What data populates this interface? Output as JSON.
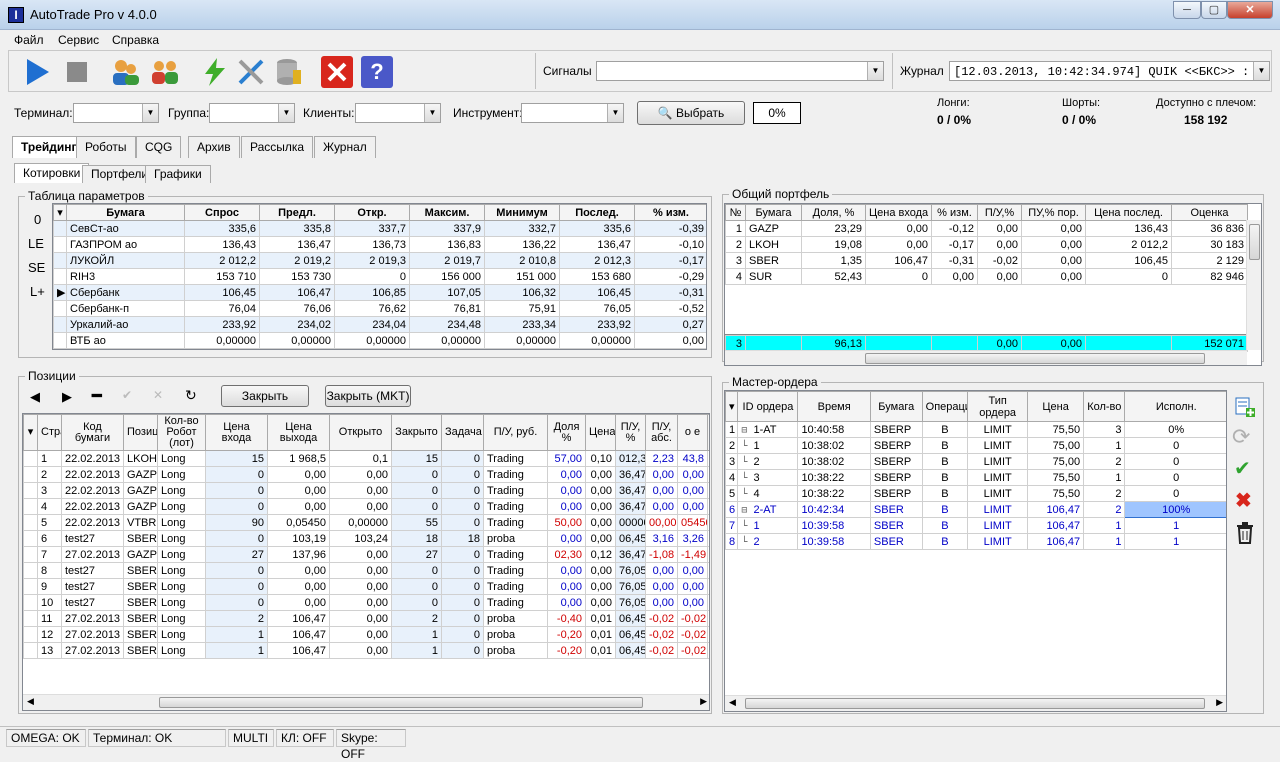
{
  "window": {
    "title": "AutoTrade Pro v 4.0.0",
    "minimize": "─",
    "maximize": "▢",
    "close": "✕"
  },
  "menu": [
    "Файл",
    "Сервис",
    "Справка"
  ],
  "toolbar": {
    "signals_label": "Сигналы",
    "signals_value": "",
    "journal_label": "Журнал",
    "journal_value": "[12.03.2013, 10:42:34.974] QUIK <<БКС>> : Т"
  },
  "filters": {
    "terminal_label": "Терминал:",
    "group_label": "Группа:",
    "clients_label": "Клиенты:",
    "instrument_label": "Инструмент:",
    "select_button": "Выбрать",
    "percent": "0%"
  },
  "summary": {
    "longs_label": "Лонги:",
    "longs_value": "0 / 0%",
    "shorts_label": "Шорты:",
    "shorts_value": "0 / 0%",
    "available_label": "Доступно с плечом:",
    "available_value": "158 192"
  },
  "tabs": [
    "Трейдинг",
    "Роботы",
    "CQG",
    "Архив",
    "Рассылка",
    "Журнал"
  ],
  "subtabs": [
    "Котировки",
    "Портфели",
    "Графики"
  ],
  "params": {
    "title": "Таблица параметров",
    "side_labels": [
      "0",
      "LE",
      "SE",
      "L+"
    ],
    "columns": [
      "Бумага",
      "Спрос",
      "Предл.",
      "Откр.",
      "Максим.",
      "Минимум",
      "Послед.",
      "% изм."
    ],
    "rows": [
      [
        "СевСт-ао",
        "335,6",
        "335,8",
        "337,7",
        "337,9",
        "332,7",
        "335,6",
        "-0,39"
      ],
      [
        "ГАЗПРОМ ао",
        "136,43",
        "136,47",
        "136,73",
        "136,83",
        "136,22",
        "136,47",
        "-0,10"
      ],
      [
        "ЛУКОЙЛ",
        "2 012,2",
        "2 019,2",
        "2 019,3",
        "2 019,7",
        "2 010,8",
        "2 012,3",
        "-0,17"
      ],
      [
        "RIH3",
        "153 710",
        "153 730",
        "0",
        "156 000",
        "151 000",
        "153 680",
        "-0,29"
      ],
      [
        "Сбербанк",
        "106,45",
        "106,47",
        "106,85",
        "107,05",
        "106,32",
        "106,45",
        "-0,31"
      ],
      [
        "Сбербанк-п",
        "76,04",
        "76,06",
        "76,62",
        "76,81",
        "75,91",
        "76,05",
        "-0,52"
      ],
      [
        "Уркалий-ао",
        "233,92",
        "234,02",
        "234,04",
        "234,48",
        "233,34",
        "233,92",
        "0,27"
      ],
      [
        "ВТБ ао",
        "0,00000",
        "0,00000",
        "0,00000",
        "0,00000",
        "0,00000",
        "0,00000",
        "0,00"
      ]
    ]
  },
  "portfolio": {
    "title": "Общий портфель",
    "columns": [
      "№",
      "Бумага",
      "Доля, %",
      "Цена входа",
      "% изм.",
      "П/У,%",
      "ПУ,% пор.",
      "Цена послед.",
      "Оценка"
    ],
    "rows": [
      [
        "1",
        "GAZP",
        "23,29",
        "0,00",
        "-0,12",
        "0,00",
        "0,00",
        "136,43",
        "36 836"
      ],
      [
        "2",
        "LKOH",
        "19,08",
        "0,00",
        "-0,17",
        "0,00",
        "0,00",
        "2 012,2",
        "30 183"
      ],
      [
        "3",
        "SBER",
        "1,35",
        "106,47",
        "-0,31",
        "-0,02",
        "0,00",
        "106,45",
        "2 129"
      ],
      [
        "4",
        "SUR",
        "52,43",
        "0",
        "0,00",
        "0,00",
        "0,00",
        "0",
        "82 946"
      ]
    ],
    "total": [
      "3",
      "",
      "96,13",
      "",
      "",
      "0,00",
      "0,00",
      "",
      "152 071"
    ]
  },
  "positions": {
    "title": "Позиции",
    "close_button": "Закрыть",
    "close_mkt_button": "Закрыть (MKT)",
    "columns": [
      "",
      "Стратегия",
      "Код бумаги",
      "Позиция",
      "Кол-во Робот (лот)",
      "Цена входа",
      "Цена выхода",
      "Открыто",
      "Закрыто",
      "Задача",
      "П/У, руб.",
      "Доля %",
      "Цена",
      "П/У, %",
      "П/У, абс.",
      "о е",
      "%"
    ],
    "rows": [
      [
        "1",
        "22.02.2013 1",
        "LKOH",
        "Long",
        "15",
        "1 968,5",
        "0,1",
        "15",
        "0",
        "Trading",
        "57,00",
        "0,10",
        "012,3",
        "2,23",
        "43,8",
        "1"
      ],
      [
        "2",
        "22.02.2013 1",
        "GAZP",
        "Long",
        "0",
        "0,00",
        "0,00",
        "0",
        "0",
        "Trading",
        "0,00",
        "0,00",
        "36,47",
        "0,00",
        "0,00",
        "1"
      ],
      [
        "3",
        "22.02.2013 1",
        "GAZP",
        "Long",
        "0",
        "0,00",
        "0,00",
        "0",
        "0",
        "Trading",
        "0,00",
        "0,00",
        "36,47",
        "0,00",
        "0,00",
        "1"
      ],
      [
        "4",
        "22.02.2013 1",
        "GAZP",
        "Long",
        "0",
        "0,00",
        "0,00",
        "0",
        "0",
        "Trading",
        "0,00",
        "0,00",
        "36,47",
        "0,00",
        "0,00",
        "1"
      ],
      [
        "5",
        "22.02.2013 1",
        "VTBR",
        "Long",
        "90",
        "0,05450",
        "0,00000",
        "55",
        "0",
        "Trading",
        "50,00",
        "0,00",
        "00000",
        "00,00",
        "05450",
        "1"
      ],
      [
        "6",
        "test27",
        "SBER",
        "Long",
        "0",
        "103,19",
        "103,24",
        "18",
        "18",
        "proba",
        "0,00",
        "0,00",
        "06,45",
        "3,16",
        "3,26",
        "1"
      ],
      [
        "7",
        "27.02.2013 1",
        "GAZP",
        "Long",
        "27",
        "137,96",
        "0,00",
        "27",
        "0",
        "Trading",
        "02,30",
        "0,12",
        "36,47",
        "-1,08",
        "-1,49",
        "1"
      ],
      [
        "8",
        "test27",
        "SBER",
        "Long",
        "0",
        "0,00",
        "0,00",
        "0",
        "0",
        "Trading",
        "0,00",
        "0,00",
        "76,05",
        "0,00",
        "0,00",
        "1"
      ],
      [
        "9",
        "test27",
        "SBER",
        "Long",
        "0",
        "0,00",
        "0,00",
        "0",
        "0",
        "Trading",
        "0,00",
        "0,00",
        "76,05",
        "0,00",
        "0,00",
        "5"
      ],
      [
        "10",
        "test27",
        "SBER",
        "Long",
        "0",
        "0,00",
        "0,00",
        "0",
        "0",
        "Trading",
        "0,00",
        "0,00",
        "76,05",
        "0,00",
        "0,00",
        "0"
      ],
      [
        "11",
        "27.02.2013 1",
        "SBER",
        "Long",
        "2",
        "106,47",
        "0,00",
        "2",
        "0",
        "proba",
        "-0,40",
        "0,01",
        "06,45",
        "-0,02",
        "-0,02",
        "0"
      ],
      [
        "12",
        "27.02.2013 1",
        "SBER",
        "Long",
        "1",
        "106,47",
        "0,00",
        "1",
        "0",
        "proba",
        "-0,20",
        "0,01",
        "06,45",
        "-0,02",
        "-0,02",
        "5"
      ],
      [
        "13",
        "27.02.2013 1",
        "SBER",
        "Long",
        "1",
        "106,47",
        "0,00",
        "1",
        "0",
        "proba",
        "-0,20",
        "0,01",
        "06,45",
        "-0,02",
        "-0,02",
        "0"
      ]
    ]
  },
  "orders": {
    "title": "Мастер-ордера",
    "columns": [
      "",
      "ID ордера",
      "Время",
      "Бумага",
      "Операция",
      "Тип ордера",
      "Цена",
      "Кол-во",
      "Исполн."
    ],
    "rows": [
      [
        "1",
        "1-AT",
        "10:40:58",
        "SBERP",
        "B",
        "LIMIT",
        "75,50",
        "3",
        "0%"
      ],
      [
        "2",
        "1",
        "10:38:02",
        "SBERP",
        "B",
        "LIMIT",
        "75,00",
        "1",
        "0"
      ],
      [
        "3",
        "2",
        "10:38:02",
        "SBERP",
        "B",
        "LIMIT",
        "75,00",
        "2",
        "0"
      ],
      [
        "4",
        "3",
        "10:38:22",
        "SBERP",
        "B",
        "LIMIT",
        "75,50",
        "1",
        "0"
      ],
      [
        "5",
        "4",
        "10:38:22",
        "SBERP",
        "B",
        "LIMIT",
        "75,50",
        "2",
        "0"
      ],
      [
        "6",
        "2-AT",
        "10:42:34",
        "SBER",
        "B",
        "LIMIT",
        "106,47",
        "2",
        "100%"
      ],
      [
        "7",
        "1",
        "10:39:58",
        "SBER",
        "B",
        "LIMIT",
        "106,47",
        "1",
        "1"
      ],
      [
        "8",
        "2",
        "10:39:58",
        "SBER",
        "B",
        "LIMIT",
        "106,47",
        "1",
        "1"
      ]
    ]
  },
  "status": [
    "OMEGA: OK",
    "Терминал: OK",
    "MULTI",
    "КЛ: OFF",
    "Skype: OFF"
  ]
}
